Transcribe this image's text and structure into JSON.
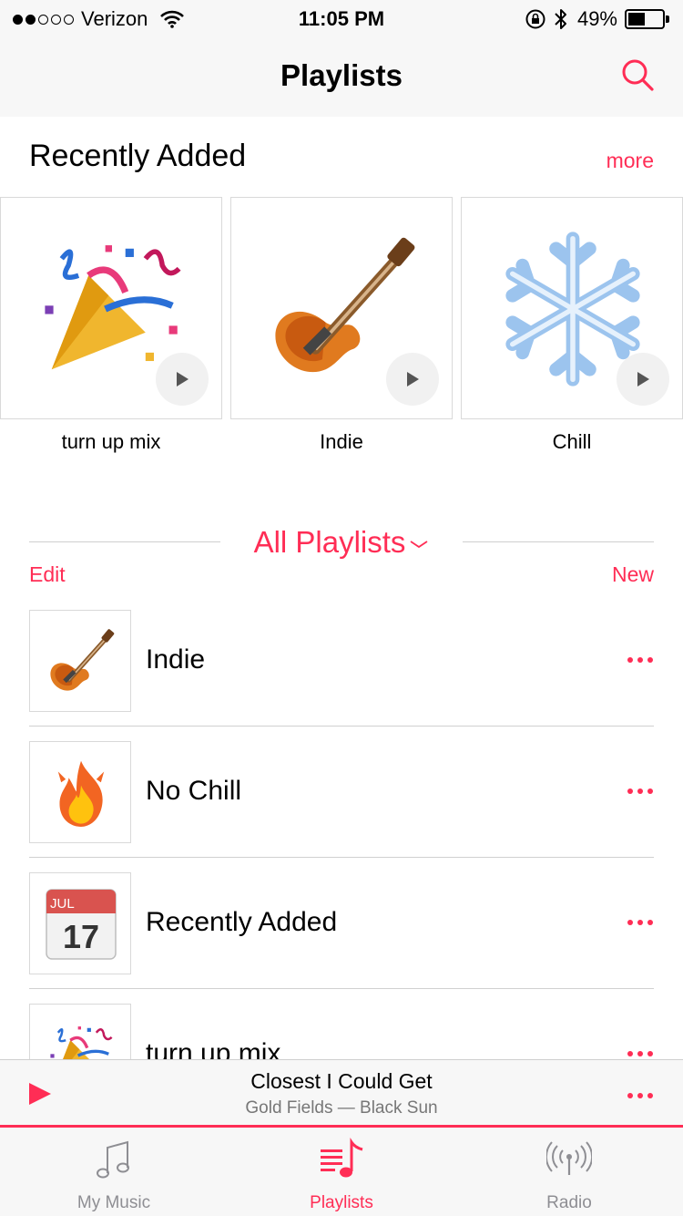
{
  "status_bar": {
    "carrier": "Verizon",
    "signal_bars_filled": 2,
    "signal_bars_total": 5,
    "time": "11:05 PM",
    "battery_text": "49%",
    "battery_level": 0.49
  },
  "nav": {
    "title": "Playlists",
    "search_icon": "search-icon"
  },
  "recently_added": {
    "title": "Recently Added",
    "more_label": "more",
    "items": [
      {
        "label": "turn up mix",
        "icon": "party-popper-icon"
      },
      {
        "label": "Indie",
        "icon": "guitar-icon"
      },
      {
        "label": "Chill",
        "icon": "snowflake-icon"
      }
    ]
  },
  "all_playlists": {
    "title": "All Playlists",
    "edit_label": "Edit",
    "new_label": "New"
  },
  "playlists": [
    {
      "name": "Indie",
      "icon": "guitar-icon"
    },
    {
      "name": "No Chill",
      "icon": "fire-icon"
    },
    {
      "name": "Recently Added",
      "icon": "calendar-icon",
      "calendar_month": "JUL",
      "calendar_day": "17"
    },
    {
      "name": "turn up mix",
      "icon": "party-popper-icon"
    }
  ],
  "now_playing": {
    "title": "Closest I Could Get",
    "subtitle": "Gold Fields — Black Sun"
  },
  "tabs": [
    {
      "label": "My Music",
      "icon": "music-note-icon",
      "active": false
    },
    {
      "label": "Playlists",
      "icon": "playlist-icon",
      "active": true
    },
    {
      "label": "Radio",
      "icon": "radio-icon",
      "active": false
    }
  ],
  "colors": {
    "accent": "#ff2d55",
    "inactive_tab": "#8e8e93",
    "bar_background": "#f7f7f7"
  }
}
